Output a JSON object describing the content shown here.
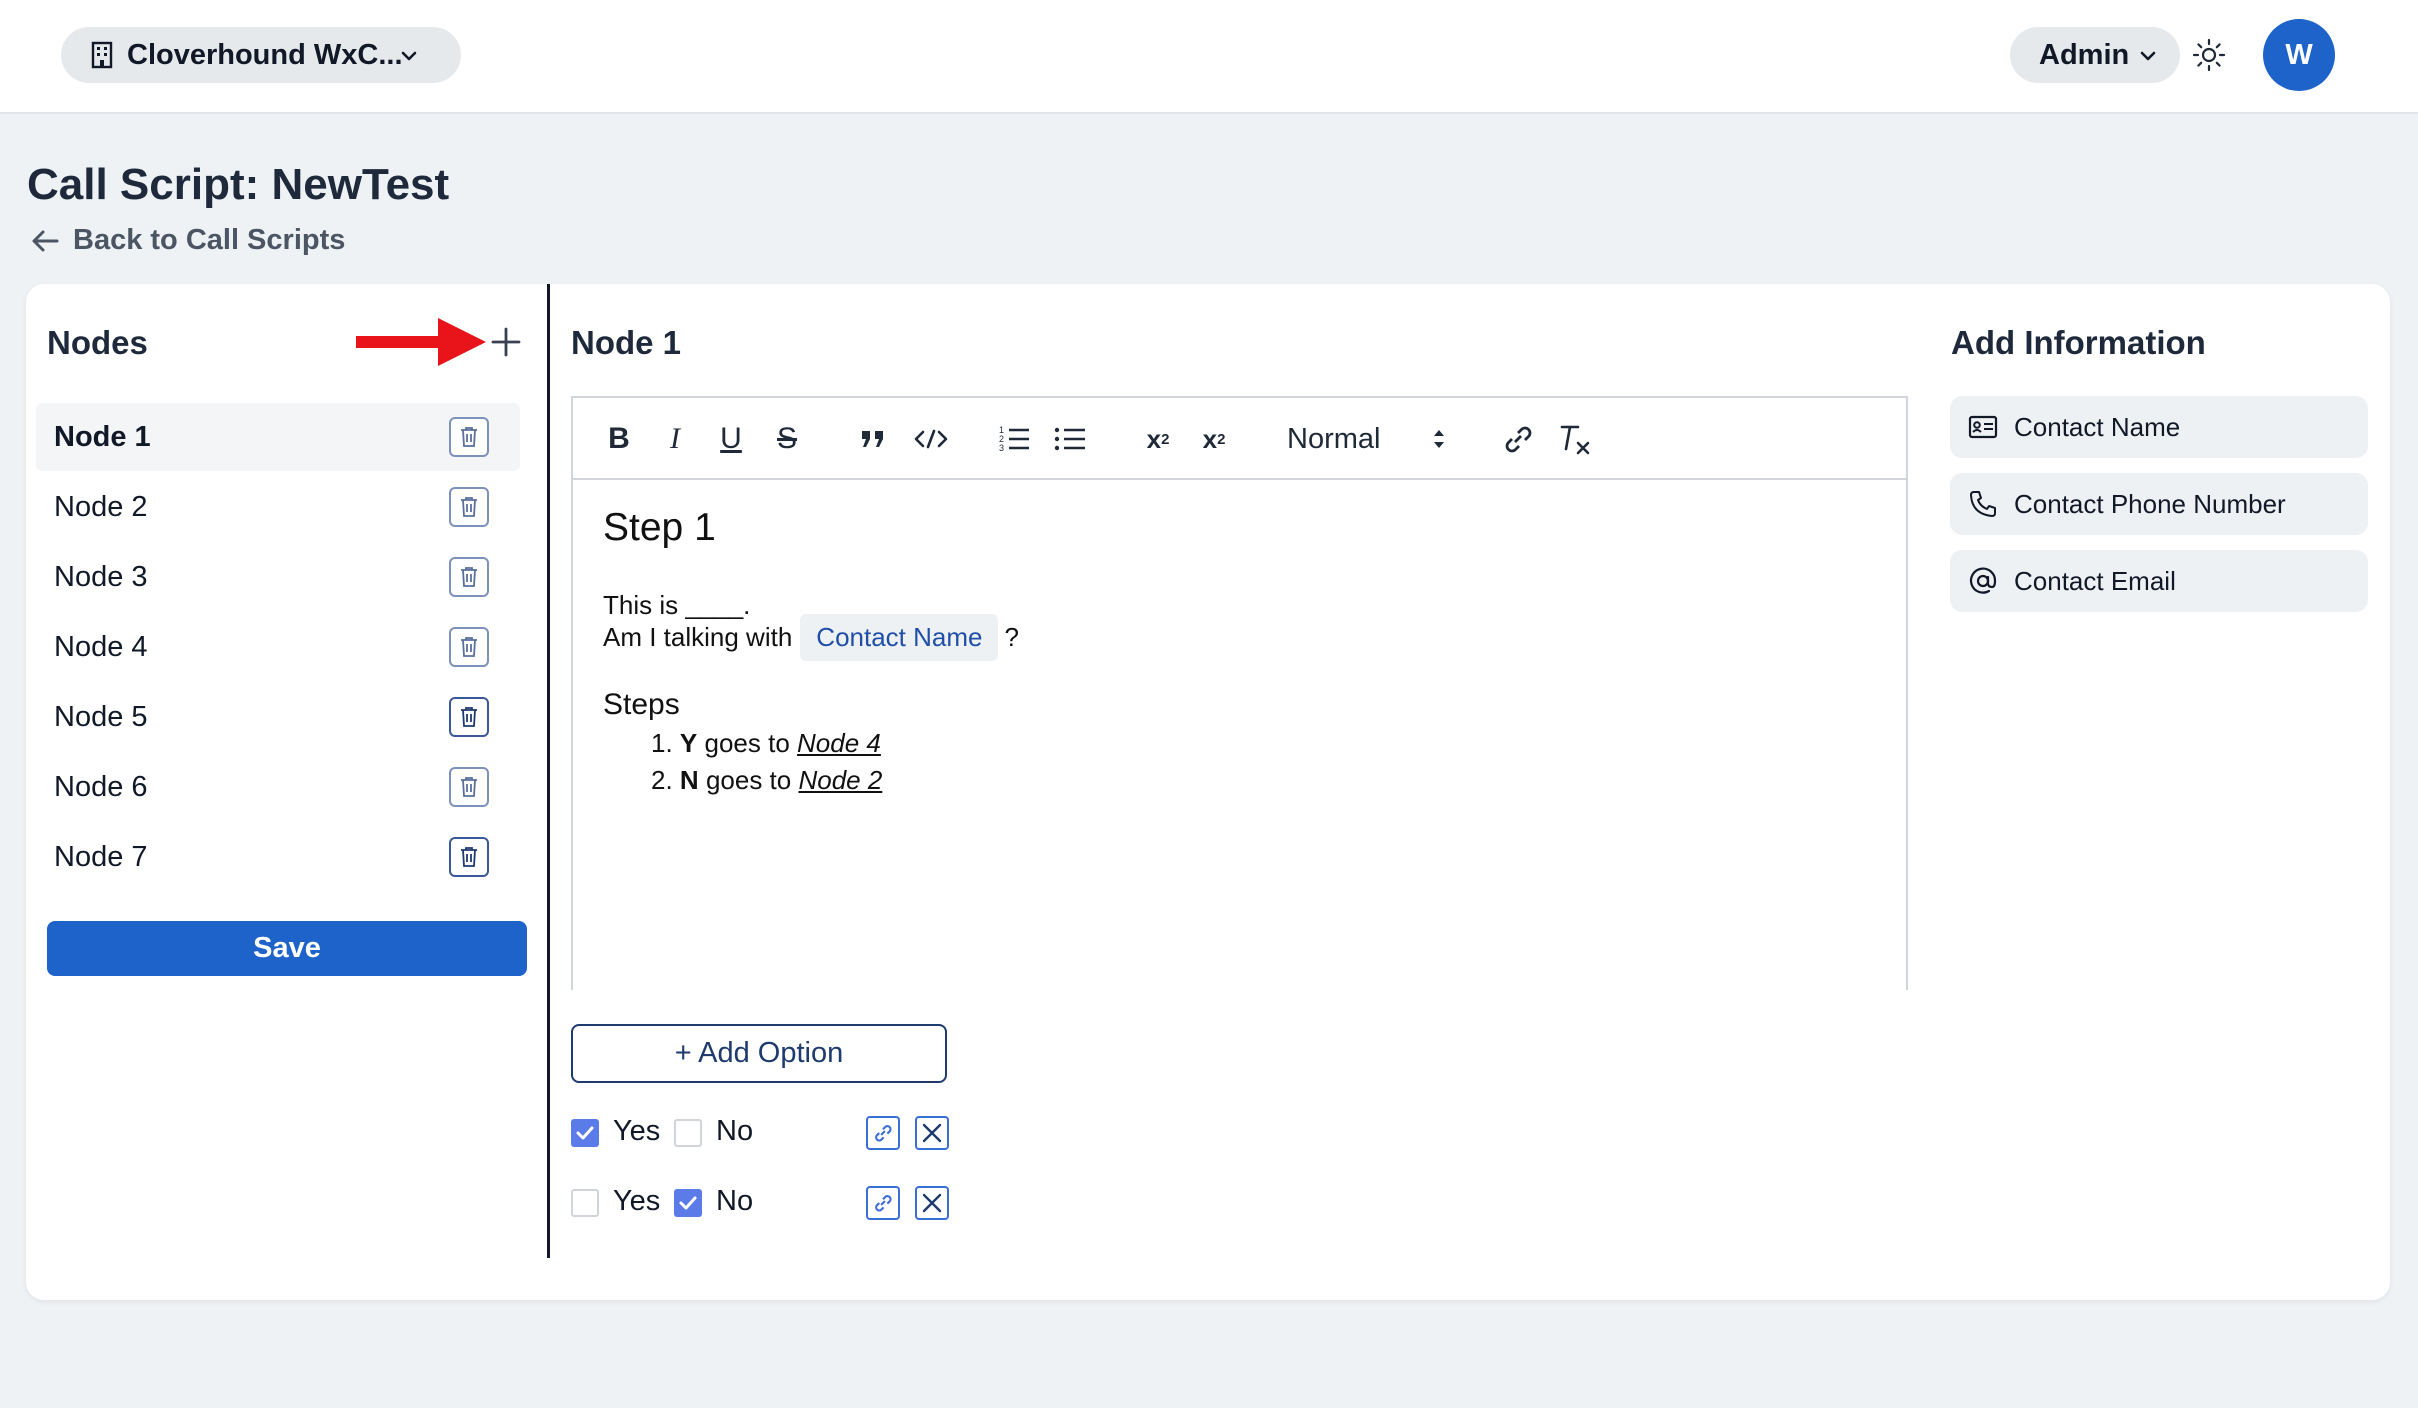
{
  "header": {
    "org_name": "Cloverhound WxC...",
    "role": "Admin",
    "avatar_initial": "W"
  },
  "page": {
    "title": "Call Script: NewTest",
    "back_label": "Back to Call Scripts"
  },
  "nodes_panel": {
    "title": "Nodes",
    "items": [
      {
        "label": "Node 1"
      },
      {
        "label": "Node 2"
      },
      {
        "label": "Node 3"
      },
      {
        "label": "Node 4"
      },
      {
        "label": "Node 5"
      },
      {
        "label": "Node 6"
      },
      {
        "label": "Node 7"
      }
    ],
    "save_label": "Save"
  },
  "editor": {
    "title": "Node 1",
    "format_select": "Normal",
    "content": {
      "heading": "Step 1",
      "line1": "This is ____.",
      "line2_prefix": "Am I talking with",
      "line2_chip": "Contact Name",
      "line2_suffix": "?",
      "steps_heading": "Steps",
      "steps": [
        {
          "num": "1.",
          "key": "Y",
          "text": "goes to",
          "link": "Node 4"
        },
        {
          "num": "2.",
          "key": "N",
          "text": "goes to",
          "link": "Node 2"
        }
      ]
    }
  },
  "options": {
    "add_label": "+ Add Option",
    "rows": [
      {
        "yes_label": "Yes",
        "no_label": "No",
        "yes_checked": true,
        "no_checked": false
      },
      {
        "yes_label": "Yes",
        "no_label": "No",
        "yes_checked": false,
        "no_checked": true
      }
    ]
  },
  "info_panel": {
    "title": "Add Information",
    "items": [
      {
        "label": "Contact Name",
        "icon": "id-card-icon"
      },
      {
        "label": "Contact Phone Number",
        "icon": "phone-icon"
      },
      {
        "label": "Contact Email",
        "icon": "at-sign-icon"
      }
    ]
  },
  "colors": {
    "primary": "#1e63c9",
    "checkbox_on": "#5b7be8",
    "annotation_arrow": "#e8141a"
  }
}
